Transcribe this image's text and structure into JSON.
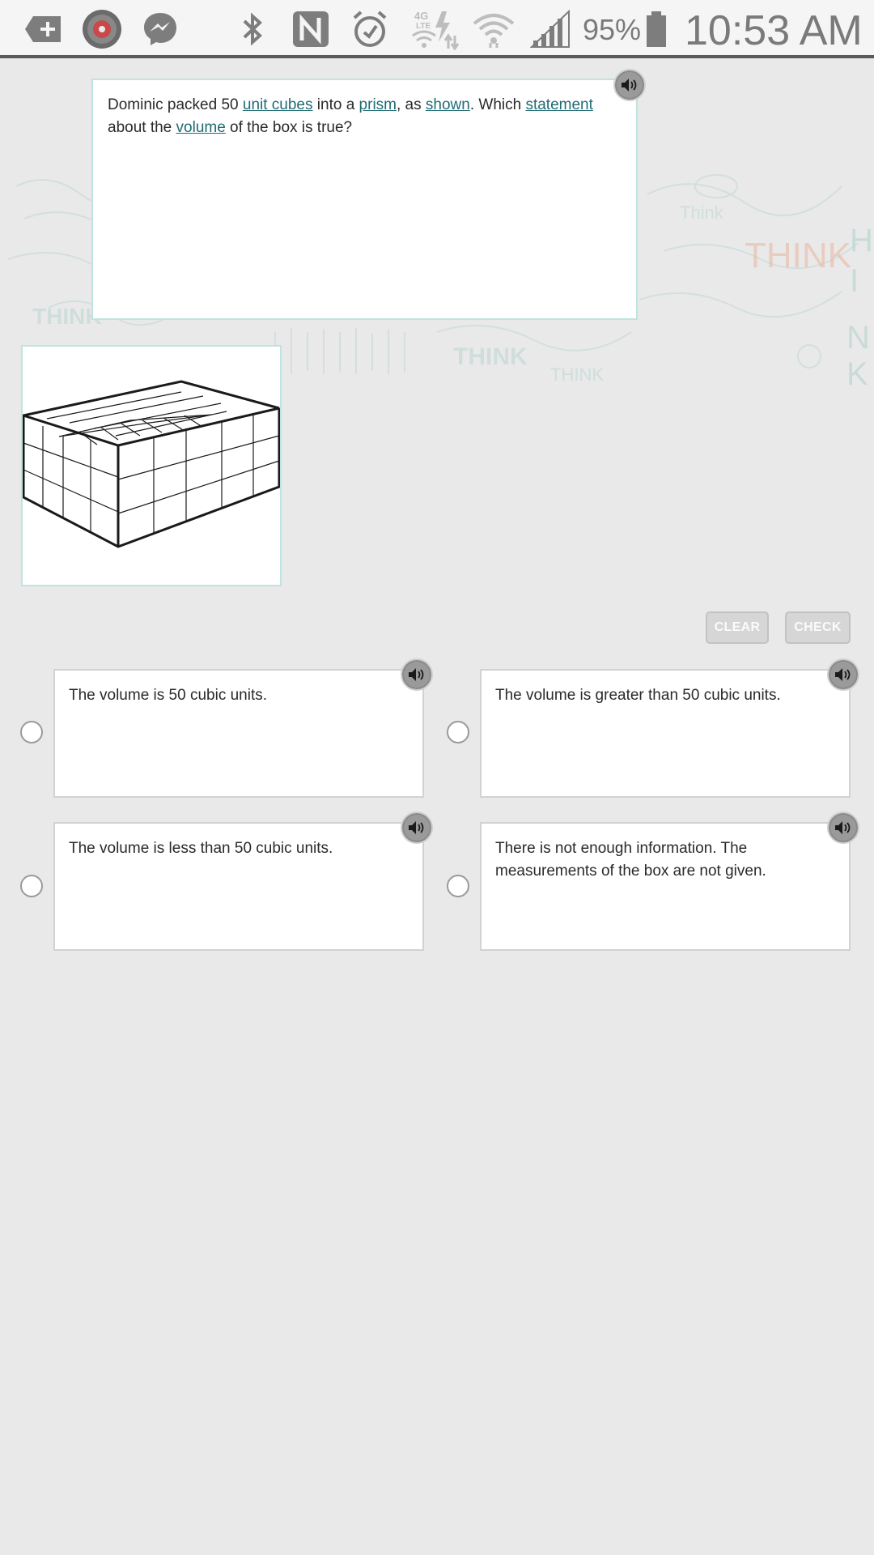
{
  "status_bar": {
    "battery_text": "95%",
    "time": "10:53 AM",
    "network_label_top": "4G",
    "network_label_bottom": "LTE"
  },
  "question": {
    "parts": [
      "Dominic packed 50 ",
      "unit cubes",
      " into a ",
      "prism",
      ", as ",
      "shown",
      ". Which ",
      "statement",
      " about the ",
      "volume",
      " of the box is true?"
    ]
  },
  "buttons": {
    "clear": "CLEAR",
    "check": "CHECK"
  },
  "choices": [
    {
      "text": "The volume is 50 cubic units."
    },
    {
      "text": "The volume is greater than 50 cubic units."
    },
    {
      "text": "The volume is less than 50 cubic units."
    },
    {
      "text": "There is not enough information. The measurements of the box are not given."
    }
  ],
  "doodle_text": [
    "THINK",
    "THINK",
    "THINK",
    "Think",
    "THINK"
  ],
  "icons": {
    "status": [
      "add-icon",
      "app-avatar-icon",
      "messenger-icon",
      "bluetooth-icon",
      "nfc-icon",
      "alarm-icon",
      "lte-icon",
      "wifi-icon",
      "signal-icon",
      "battery-icon"
    ],
    "audio": "speaker-icon"
  },
  "colors": {
    "link": "#1f6b73",
    "card_border": "#bfe4e0",
    "button_bg": "#d6d6d6",
    "doodle_accent": "#e8b9a5"
  }
}
